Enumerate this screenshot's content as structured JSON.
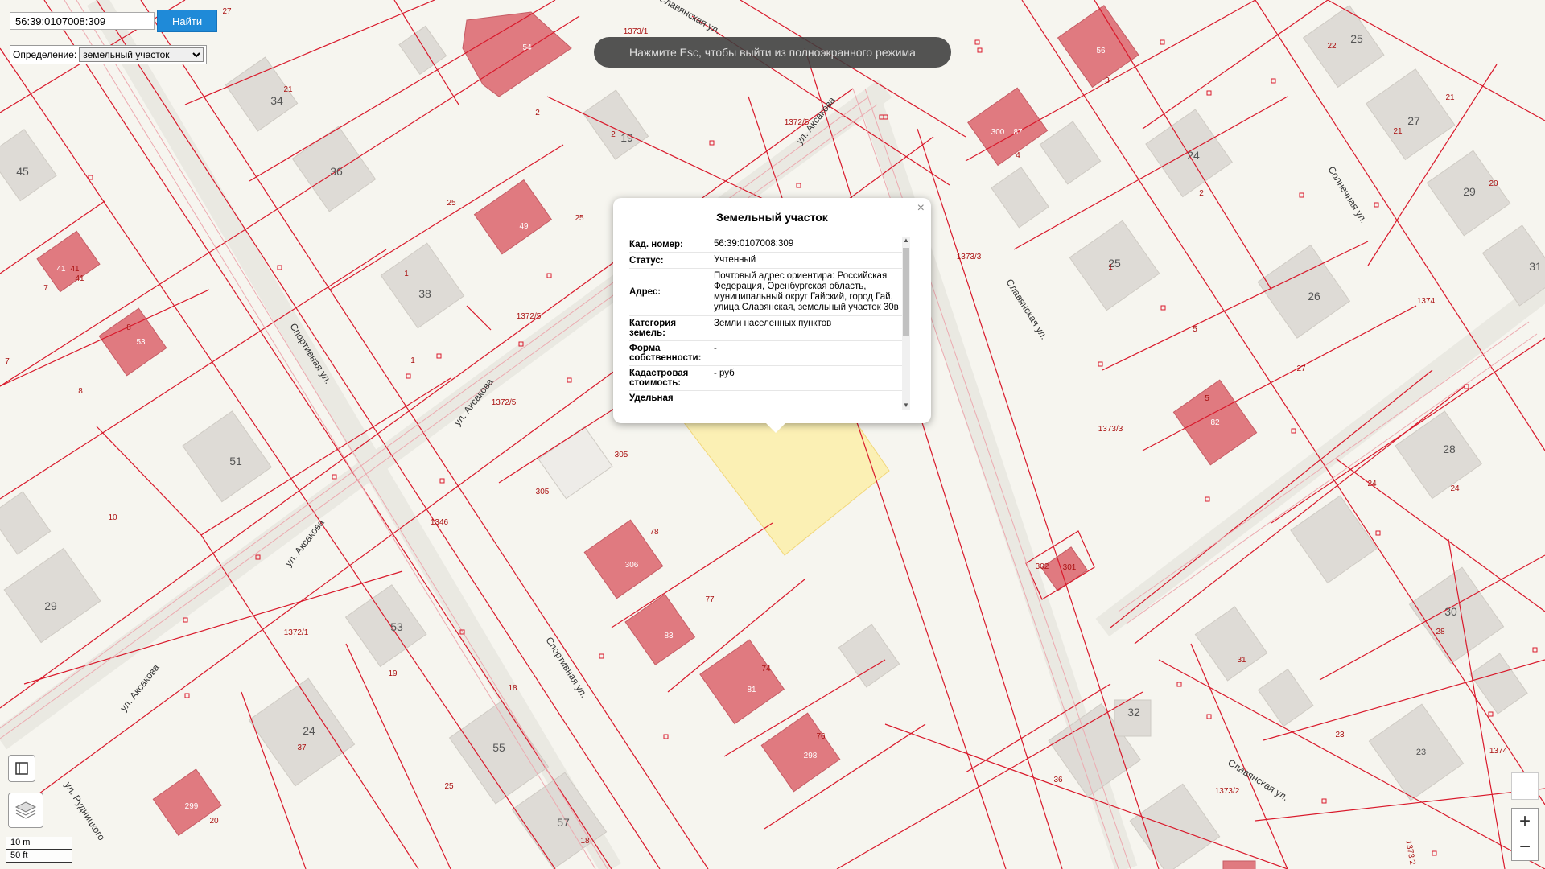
{
  "search": {
    "value": "56:39:0107008:309",
    "button": "Найти"
  },
  "definition": {
    "label": "Определение:",
    "selected": "земельный участок"
  },
  "fullscreen_message": "Нажмите Esc, чтобы выйти из полноэкранного режима",
  "popup": {
    "title": "Земельный участок",
    "close": "×",
    "rows": [
      {
        "label": "Кад. номер:",
        "value": "56:39:0107008:309"
      },
      {
        "label": "Статус:",
        "value": "Учтенный"
      },
      {
        "label": "Адрес:",
        "value": "Почтовый адрес ориентира: Российская Федерация, Оренбургская область, муниципальный округ Гайский, город Гай, улица Славянская, земельный участок 30в"
      },
      {
        "label": "Категория земель:",
        "value": "Земли населенных пунктов"
      },
      {
        "label": "Форма собственности:",
        "value": "-"
      },
      {
        "label": "Кадастровая стоимость:",
        "value": "- руб"
      },
      {
        "label": "Удельная",
        "value": ""
      }
    ]
  },
  "scale": {
    "metric": "10 m",
    "imperial": "50 ft"
  },
  "zoom": {
    "in": "+",
    "out": "−"
  },
  "colors": {
    "parcel_line": "#d9192b",
    "building_pink": "#e07a80",
    "building_gray": "#dedbd6",
    "highlight": "#fbf0b4",
    "button_blue": "#1f8ad8"
  },
  "map_labels": {
    "streets": [
      "Спортивная ул.",
      "Спортивная ул.",
      "ул. Аксакова",
      "ул. Аксакова",
      "ул. Аксакова",
      "ул. Аксакова",
      "Славянская ул.",
      "Славянская ул.",
      "Солнечная ул.",
      "ул. Рудницкого",
      "Славянская ул."
    ],
    "houses": [
      "54",
      "56",
      "34",
      "36",
      "19",
      "300",
      "87",
      "25",
      "45",
      "38",
      "24",
      "25",
      "27",
      "29",
      "31",
      "51",
      "29",
      "53",
      "24",
      "55",
      "57",
      "26",
      "28",
      "30",
      "32",
      "23",
      "82",
      "81",
      "83",
      "305",
      "306",
      "298",
      "299",
      "41",
      "53",
      "49"
    ],
    "parcels": [
      "27",
      "21",
      "2",
      "2",
      "3",
      "4",
      "22",
      "21",
      "21",
      "20",
      "25",
      "7",
      "8",
      "1",
      "25",
      "1372/5",
      "1372/5",
      "1373/1",
      "1372/5",
      "1373/3",
      "1374",
      "1373/3",
      "1346",
      "10",
      "305",
      "78",
      "77",
      "76",
      "74",
      "5",
      "5",
      "27",
      "24",
      "24",
      "28",
      "302",
      "301",
      "1372/1",
      "19",
      "37",
      "25",
      "18",
      "20",
      "36",
      "31",
      "23",
      "1374",
      "1373/2",
      "1373/2",
      "8",
      "7",
      "41",
      "41",
      "1",
      "1",
      "2",
      "18"
    ]
  }
}
